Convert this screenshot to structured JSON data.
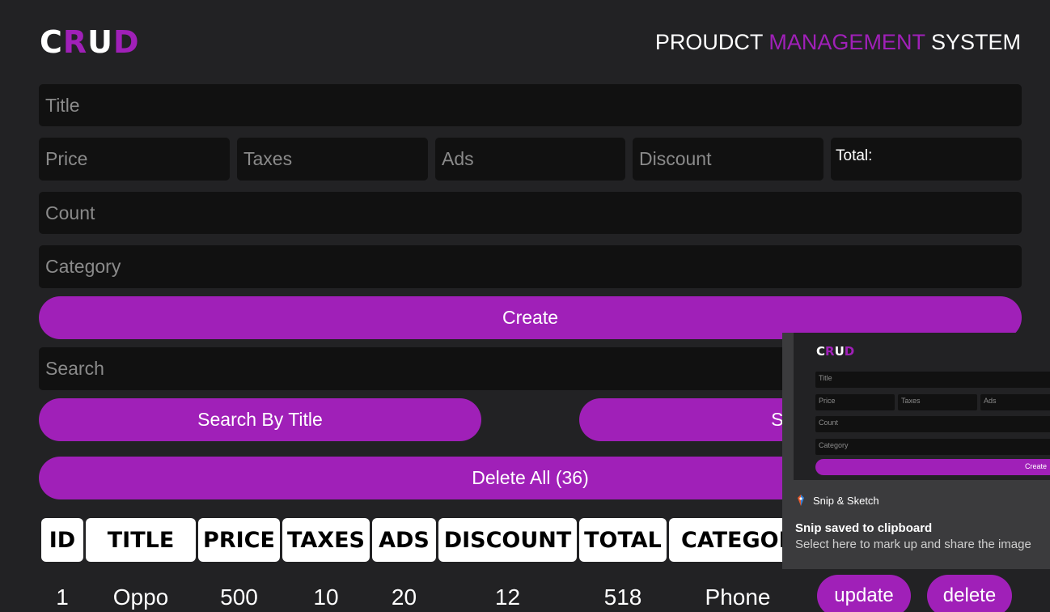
{
  "logo": {
    "c": "C",
    "r": "R",
    "u": "U",
    "d": "D"
  },
  "header": {
    "part1": "PROUDCT",
    "part2": "MANAGEMENT",
    "part3": "SYSTEM"
  },
  "form": {
    "title_placeholder": "Title",
    "price_placeholder": "Price",
    "taxes_placeholder": "Taxes",
    "ads_placeholder": "Ads",
    "discount_placeholder": "Discount",
    "total_label": "Total:",
    "count_placeholder": "Count",
    "category_placeholder": "Category",
    "create_label": "Create"
  },
  "search": {
    "placeholder": "Search",
    "by_title_label": "Search By Title",
    "by_category_label": "Search"
  },
  "delete_all_label": "Delete All (36)",
  "table": {
    "headers": [
      "ID",
      "TITLE",
      "PRICE",
      "TAXES",
      "ADS",
      "DISCOUNT",
      "TOTAL",
      "CATEGORY"
    ],
    "rows": [
      {
        "id": "1",
        "title": "Oppo",
        "price": "500",
        "taxes": "10",
        "ads": "20",
        "discount": "12",
        "total": "518",
        "category": "Phone",
        "update_label": "update",
        "delete_label": "delete"
      }
    ]
  },
  "toast": {
    "app_name": "Snip & Sketch",
    "heading": "Snip saved to clipboard",
    "body": "Select here to mark up and share the image",
    "preview": {
      "logo": {
        "c": "C",
        "r": "R",
        "u": "U",
        "d": "D"
      },
      "title": "Title",
      "price": "Price",
      "taxes": "Taxes",
      "ads": "Ads",
      "count": "Count",
      "category": "Category",
      "create": "Create"
    }
  },
  "colors": {
    "accent": "#a020b8",
    "background": "#222224",
    "input_bg": "#111111",
    "toast_bg": "#3b3b3d"
  }
}
